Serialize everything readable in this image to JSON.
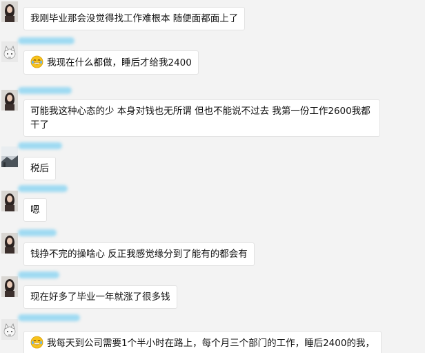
{
  "messages": [
    {
      "sender": "girl",
      "text": "我刚毕业那会没觉得找工作难根本 随便面都面上了"
    },
    {
      "sender": "cat",
      "emoji": "laughing-tears-emoji",
      "text": "我现在什么都做，睡后才给我2400"
    },
    {
      "sender": "girl",
      "text": "可能我这种心态的少 本身对钱也无所谓 但也不能说不过去 我第一份工作2600我都干了"
    },
    {
      "sender": "landscape",
      "text": "税后"
    },
    {
      "sender": "girl",
      "text": "嗯"
    },
    {
      "sender": "girl",
      "text": "钱挣不完的操啥心 反正我感觉缘分到了能有的都会有"
    },
    {
      "sender": "girl",
      "text": "现在好多了毕业一年就涨了很多钱"
    },
    {
      "sender": "cat",
      "emoji": "laughing-tears-emoji",
      "text": "我每天到公司需要1个半小时在路上，每个月三个部门的工作，睡后2400的我，"
    }
  ],
  "colors": {
    "background": "#f3f3f3",
    "bubble": "#ffffff",
    "name_blur": "#9fdaf2"
  }
}
